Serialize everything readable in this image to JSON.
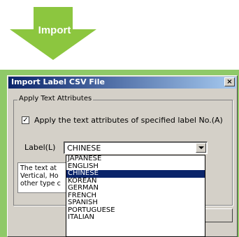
{
  "banner": {
    "label": "Import",
    "color": "#8cc63f"
  },
  "dialog": {
    "title": "Import Label CSV File",
    "close_glyph": "×",
    "group_label": "Apply Text Attributes",
    "checkbox": {
      "checked": true,
      "mark": "✓",
      "label": "Apply the text attributes of specified label No.(A)"
    },
    "language_label": "Label(L)",
    "language_value": "CHINESE",
    "description_lines": [
      "The text at",
      "Vertical, Ho",
      "other type c"
    ]
  },
  "dropdown": {
    "options": [
      "JAPANESE",
      "ENGLISH",
      "CHINESE",
      "KOREAN",
      "GERMAN",
      "FRENCH",
      "SPANISH",
      "PORTUGUESE",
      "ITALIAN"
    ],
    "selected": "CHINESE"
  },
  "colors": {
    "frame": "#8fc968",
    "titlebar": "#0a246a",
    "selection": "#0a246a"
  }
}
